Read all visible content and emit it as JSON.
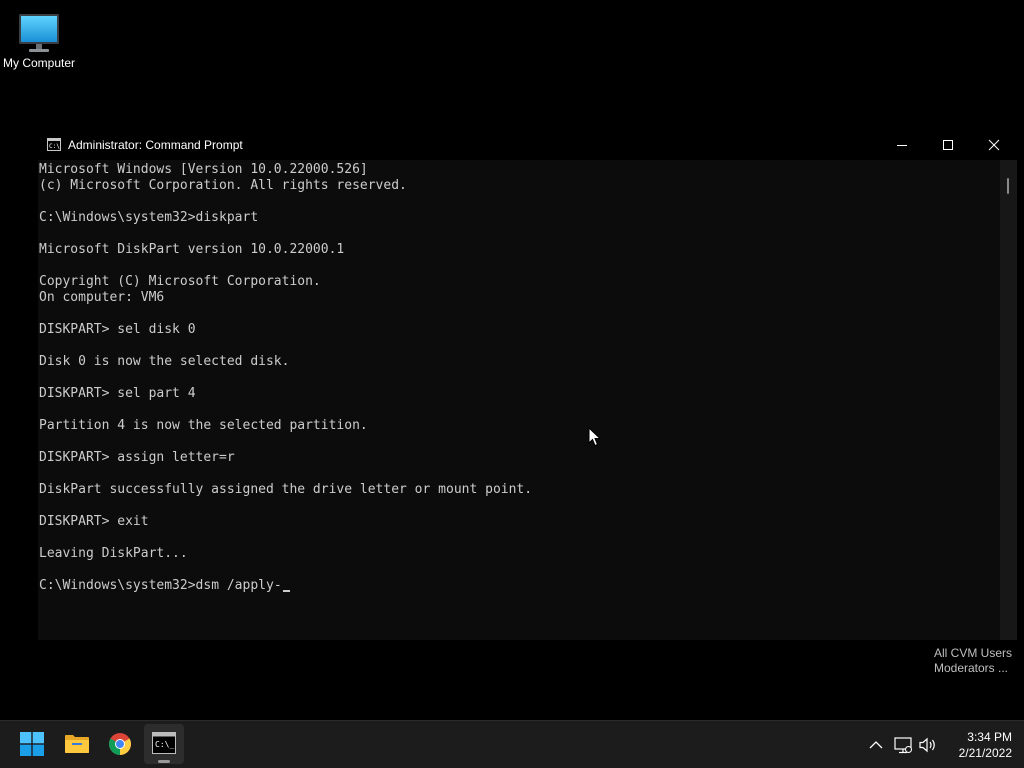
{
  "desktop": {
    "icons": [
      {
        "label": "My Computer",
        "icon": "monitor-icon"
      }
    ]
  },
  "window": {
    "title": "Administrator: Command Prompt",
    "icon": "cmd-icon",
    "controls": [
      "minimize-icon",
      "maximize-icon",
      "close-icon"
    ],
    "console": {
      "lines": [
        "Microsoft Windows [Version 10.0.22000.526]",
        "(c) Microsoft Corporation. All rights reserved.",
        "",
        "C:\\Windows\\system32>diskpart",
        "",
        "Microsoft DiskPart version 10.0.22000.1",
        "",
        "Copyright (C) Microsoft Corporation.",
        "On computer: VM6",
        "",
        "DISKPART> sel disk 0",
        "",
        "Disk 0 is now the selected disk.",
        "",
        "DISKPART> sel part 4",
        "",
        "Partition 4 is now the selected partition.",
        "",
        "DISKPART> assign letter=r",
        "",
        "DiskPart successfully assigned the drive letter or mount point.",
        "",
        "DISKPART> exit",
        "",
        "Leaving DiskPart...",
        ""
      ],
      "prompt": "C:\\Windows\\system32>",
      "current_input": "dsm /apply-"
    }
  },
  "watermark": {
    "line1": "All CVM Users",
    "line2": "Moderators ..."
  },
  "taskbar": {
    "apps": [
      {
        "name": "Start",
        "icon": "windows-start-icon"
      },
      {
        "name": "File Explorer",
        "icon": "folder-icon"
      },
      {
        "name": "Google Chrome",
        "icon": "chrome-icon"
      },
      {
        "name": "Command Prompt",
        "icon": "cmd-icon",
        "active": true
      }
    ],
    "tray": [
      "chevron-up-icon",
      "network-icon",
      "volume-icon"
    ],
    "time": "3:34 PM",
    "date": "2/21/2022"
  },
  "colors": {
    "console_bg": "#0c0c0c",
    "console_text": "#cccccc",
    "taskbar_bg": "#1c1c1c"
  }
}
